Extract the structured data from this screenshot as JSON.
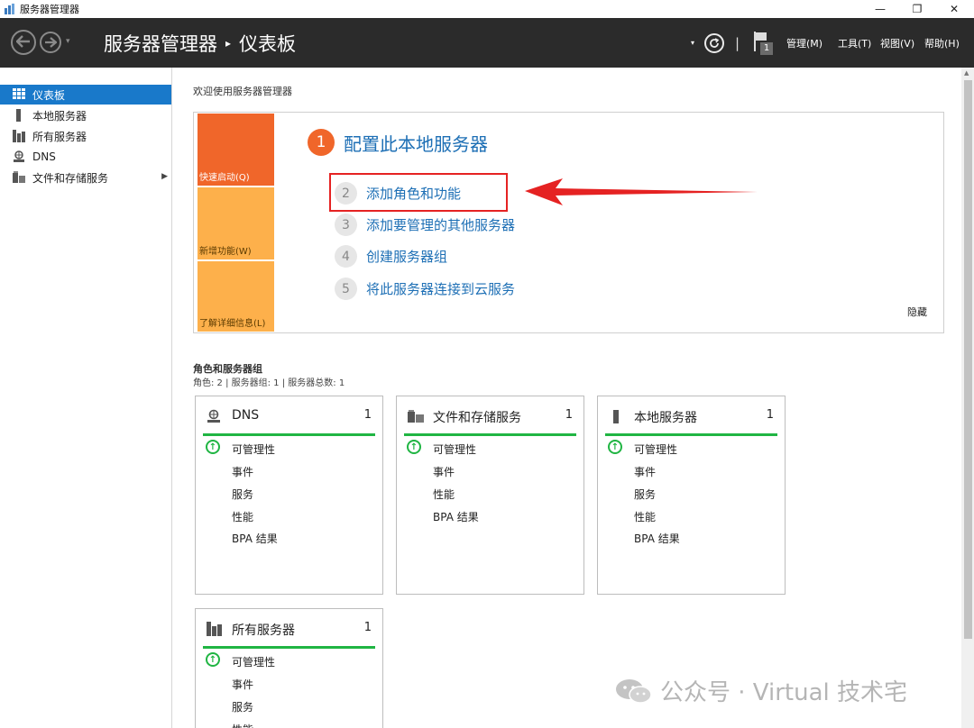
{
  "window": {
    "title": "服务器管理器",
    "min": "—",
    "max": "❐",
    "close": "✕"
  },
  "header": {
    "app": "服务器管理器",
    "separator": "▸",
    "page": "仪表板",
    "dropdown": "▾",
    "bar": "|",
    "notification_count": "1",
    "menus": [
      "管理(M)",
      "工具(T)",
      "视图(V)",
      "帮助(H)"
    ]
  },
  "sidebar": {
    "items": [
      {
        "label": "仪表板",
        "icon": "dashboard-icon",
        "active": true
      },
      {
        "label": "本地服务器",
        "icon": "local-server-icon"
      },
      {
        "label": "所有服务器",
        "icon": "all-servers-icon"
      },
      {
        "label": "DNS",
        "icon": "dns-icon"
      },
      {
        "label": "文件和存储服务",
        "icon": "file-storage-icon",
        "arrow": "▶"
      }
    ]
  },
  "welcome": {
    "title": "欢迎使用服务器管理器",
    "tiles": [
      "快速启动(Q)",
      "新增功能(W)",
      "了解详细信息(L)"
    ],
    "steps": [
      {
        "num": "1",
        "label": "配置此本地服务器"
      },
      {
        "num": "2",
        "label": "添加角色和功能"
      },
      {
        "num": "3",
        "label": "添加要管理的其他服务器"
      },
      {
        "num": "4",
        "label": "创建服务器组"
      },
      {
        "num": "5",
        "label": "将此服务器连接到云服务"
      }
    ],
    "hide": "隐藏"
  },
  "roles": {
    "title": "角色和服务器组",
    "subtitle": "角色: 2 | 服务器组: 1 | 服务器总数: 1",
    "cards": [
      {
        "name": "DNS",
        "count": "1",
        "icon": "dns-icon",
        "rows": [
          "可管理性",
          "事件",
          "服务",
          "性能",
          "BPA 结果"
        ]
      },
      {
        "name": "文件和存储服务",
        "count": "1",
        "icon": "file-storage-icon",
        "rows": [
          "可管理性",
          "事件",
          "性能",
          "BPA 结果"
        ]
      },
      {
        "name": "本地服务器",
        "count": "1",
        "icon": "local-server-icon",
        "rows": [
          "可管理性",
          "事件",
          "服务",
          "性能",
          "BPA 结果"
        ]
      },
      {
        "name": "所有服务器",
        "count": "1",
        "icon": "all-servers-icon",
        "rows": [
          "可管理性",
          "事件",
          "服务",
          "性能"
        ]
      }
    ],
    "status_glyph": "↑"
  },
  "watermark": {
    "text": "公众号 · Virtual 技术宅"
  },
  "colors": {
    "header_bg": "#2b2b2b",
    "accent_blue": "#1979ca",
    "tile_orange": "#f0662a",
    "tile_yellow": "#fdb04b",
    "link_blue": "#1d6fb5",
    "status_green": "#20b543",
    "annotation_red": "#e52222"
  }
}
